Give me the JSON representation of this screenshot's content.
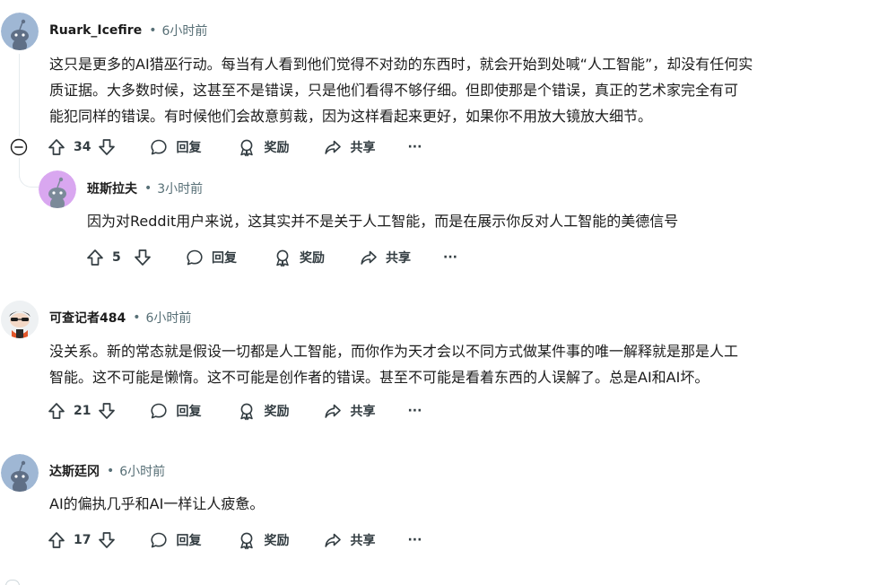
{
  "comments": [
    {
      "author": "Ruark_Icefire",
      "time": "6小时前",
      "body_lines": [
        "这只是更多的AI猎巫行动。每当有人看到他们觉得不对劲的东西时，就会开始到处喊“人工智能”，却没有任何实",
        "质证据。大多数时候，这甚至不是错误，只是他们看得不够仔细。但即使那是个错误，真正的艺术家完全有可",
        "能犯同样的错误。有时候他们会故意剪裁，因为这样看起来更好，如果你不用放大镜放大细节。"
      ],
      "votes": "34",
      "avatar_color": "#9fb7d4"
    },
    {
      "author": "班斯拉夫",
      "time": "3小时前",
      "body_lines": [
        "因为对Reddit用户来说，这其实并不是关于人工智能，而是在展示你反对人工智能的美德信号"
      ],
      "votes": "5",
      "avatar_color": "#d9a7f0"
    },
    {
      "author": "可查记者484",
      "time": "6小时前",
      "body_lines": [
        "没关系。新的常态就是假设一切都是人工智能，而你作为天才会以不同方式做某件事的唯一解释就是那是人工",
        "智能。这不可能是懒惰。这不可能是创作者的错误。甚至不可能是看着东西的人误解了。总是AI和AI坏。"
      ],
      "votes": "21",
      "avatar_color": "#cfd8dc"
    },
    {
      "author": "达斯廷冈",
      "time": "6小时前",
      "body_lines": [
        "AI的偏执几乎和AI一样让人疲惫。"
      ],
      "votes": "17",
      "avatar_color": "#9fb7d4"
    }
  ],
  "actions": {
    "reply": "回复",
    "award": "奖励",
    "share": "共享",
    "more": "···"
  },
  "meta_separator": "•",
  "icons": {
    "upvote": "upvote-icon",
    "downvote": "downvote-icon",
    "reply": "comment-bubble-icon",
    "award": "award-icon",
    "share": "share-arrow-icon",
    "more": "ellipsis-icon",
    "collapse": "collapse-minus-icon"
  },
  "colors": {
    "text": "#1c1c1c",
    "meta": "#576f76",
    "action": "#333d42",
    "thread_line": "#e5ebee"
  }
}
